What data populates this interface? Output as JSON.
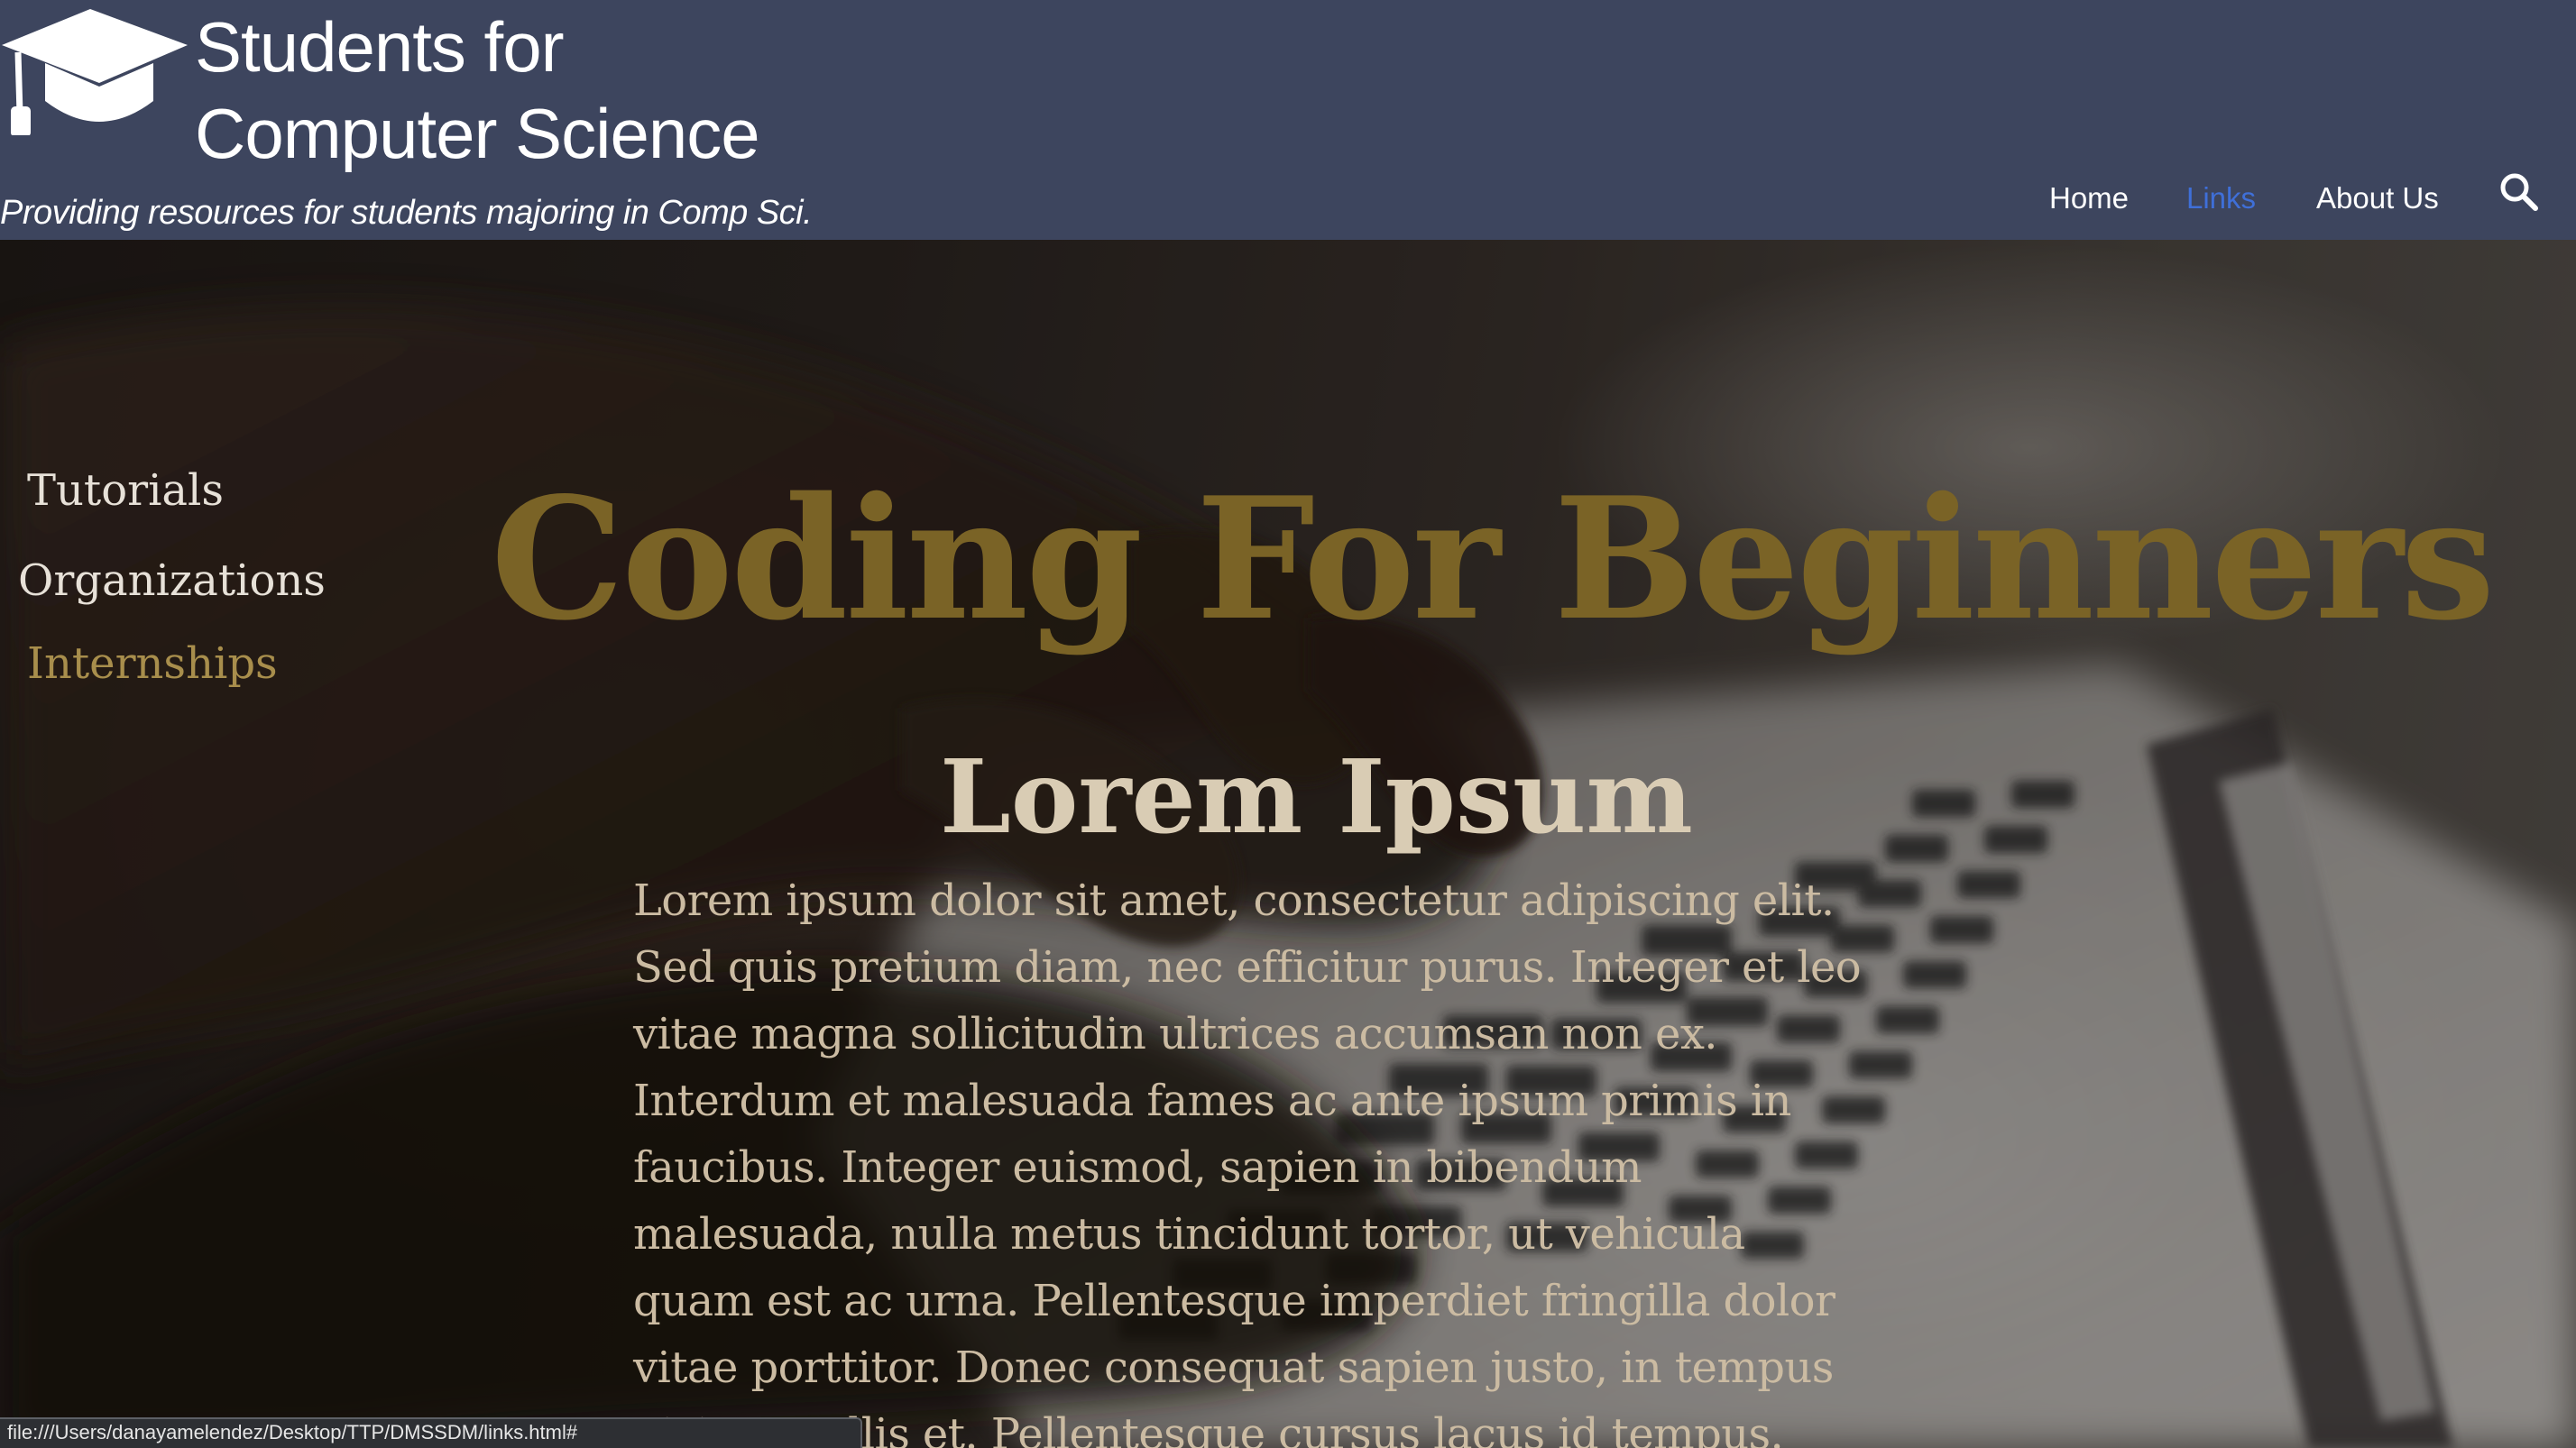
{
  "header": {
    "title_line1": "Students for",
    "title_line2": "Computer Science",
    "tagline": "Providing resources for students majoring in Comp Sci.",
    "logo_icon": "graduation-cap-icon",
    "background_color": "#3d455e"
  },
  "nav": {
    "items": [
      {
        "label": "Home",
        "active": false
      },
      {
        "label": "Links",
        "active": true
      },
      {
        "label": "About Us",
        "active": false
      }
    ],
    "active_color": "#3f6fd8",
    "search_icon": "search-icon"
  },
  "sidebar": {
    "items": [
      {
        "label": "Tutorials"
      },
      {
        "label": "Organizations"
      },
      {
        "label": "Internships"
      }
    ],
    "highlight_color": "#a88e4c"
  },
  "main": {
    "heading": "Coding For Beginners",
    "subheading": "Lorem Ipsum",
    "body": "Lorem ipsum dolor sit amet, consectetur adipiscing elit. Sed quis pretium diam, nec efficitur purus. Integer et leo vitae magna sollicitudin ultrices accumsan non ex. Interdum et malesuada fames ac ante ipsum primis in faucibus. Integer euismod, sapien in bibendum malesuada, nulla metus tincidunt tortor, ut vehicula quam est ac urna. Pellentesque imperdiet fringilla dolor vitae porttitor. Donec consequat sapien justo, in tempus nisi convallis et. Pellentesque cursus lacus id tempus.",
    "heading_color": "#7a6326"
  },
  "status_bar": {
    "url": "file:///Users/danayamelendez/Desktop/TTP/DMSSDM/links.html#"
  }
}
